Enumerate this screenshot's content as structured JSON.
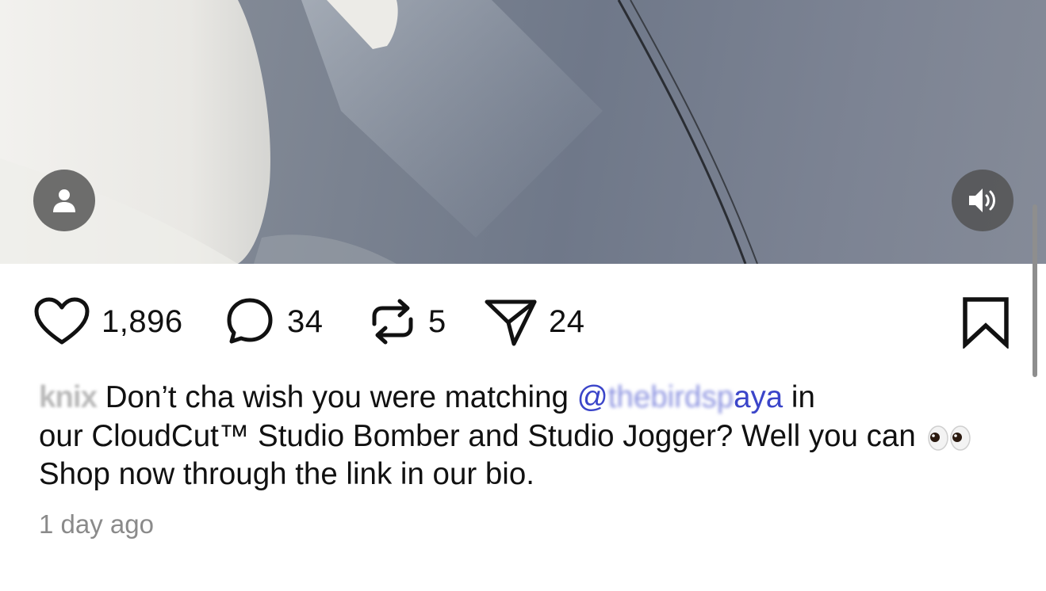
{
  "media": {
    "tags_button_icon": "user-icon",
    "sound_button_icon": "speaker-volume-icon"
  },
  "actions": {
    "like": {
      "icon": "heart-icon",
      "count": "1,896"
    },
    "comment": {
      "icon": "comment-bubble-icon",
      "count": "34"
    },
    "repost": {
      "icon": "repost-icon",
      "count": "5"
    },
    "share": {
      "icon": "send-icon",
      "count": "24"
    },
    "bookmark": {
      "icon": "bookmark-icon"
    }
  },
  "caption": {
    "username": "knix",
    "text_before_mention": " Don’t cha wish you were matching ",
    "mention_prefix": "@",
    "mention_obscured": "thebirdsp",
    "mention_suffix": "aya",
    "text_line_1_end": " in",
    "text_middle": "our CloudCut™ Studio Bomber and Studio Jogger? Well you can ",
    "emoji": "👀",
    "text_after_emoji": " Shop now through the link in our bio."
  },
  "timestamp": "1 day ago",
  "colors": {
    "mention": "#3b45c9",
    "text": "#111111",
    "muted": "#8a8a8a",
    "media_button_bg": "#505050"
  }
}
